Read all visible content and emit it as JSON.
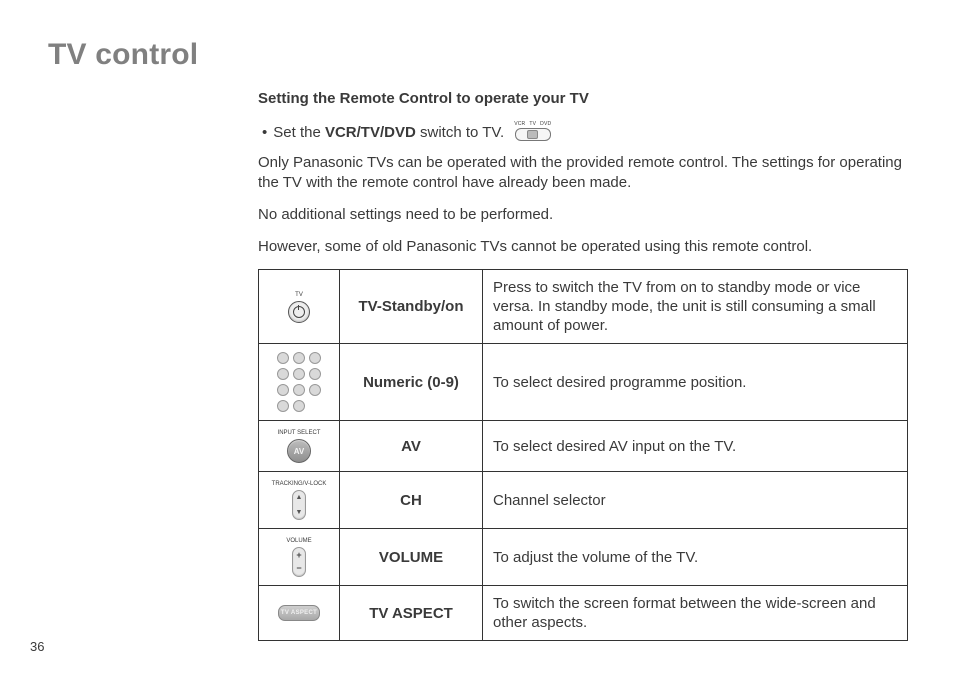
{
  "title": "TV control",
  "subheading": "Setting the Remote Control to operate your TV",
  "bullet": {
    "pre": "Set the ",
    "bold": "VCR/TV/DVD",
    "post": " switch to TV."
  },
  "switch_labels": {
    "l": "VCR",
    "c": "TV",
    "r": "DVD"
  },
  "para1": "Only Panasonic TVs can be operated with the provided remote control. The settings for operating the TV with the remote control have already been made.",
  "para2": "No additional settings need to be performed.",
  "para3": "However, some of old Panasonic TVs cannot be operated using this remote control.",
  "rows": {
    "standby": {
      "icon_label": "TV",
      "name": "TV-Standby/on",
      "desc": "Press to switch the TV from on to standby mode or vice versa. In standby mode, the unit is still consuming a small amount of power."
    },
    "numeric": {
      "name": "Numeric (0-9)",
      "desc": "To select desired programme position."
    },
    "av": {
      "icon_label": "INPUT SELECT",
      "btn": "AV",
      "name": "AV",
      "desc": "To select desired AV input on the TV."
    },
    "ch": {
      "icon_label": "TRACKING/V-LOCK",
      "name": "CH",
      "desc": "Channel selector"
    },
    "volume": {
      "icon_label": "VOLUME",
      "name": "VOLUME",
      "desc": "To adjust the volume of the TV."
    },
    "aspect": {
      "btn": "TV ASPECT",
      "name": "TV ASPECT",
      "desc": "To switch the screen format between the wide-screen and other aspects."
    }
  },
  "page_number": "36"
}
